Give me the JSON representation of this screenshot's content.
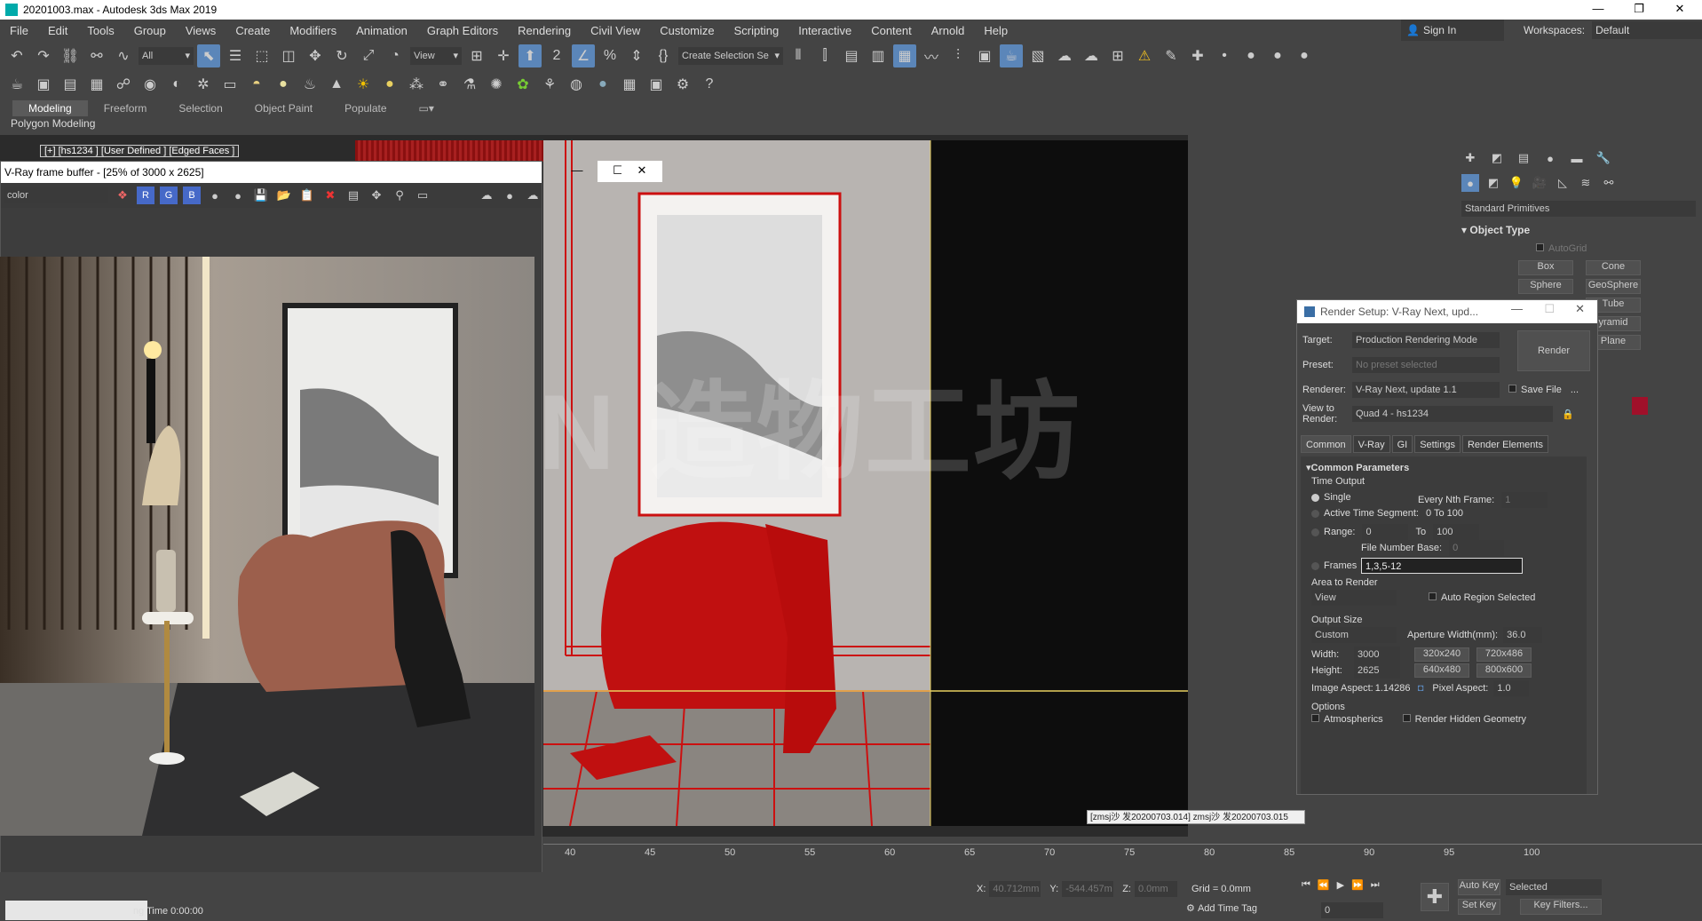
{
  "titlebar": {
    "title": "20201003.max - Autodesk 3ds Max 2019",
    "min": "—",
    "restore": "❐",
    "close": "✕"
  },
  "menu": [
    "File",
    "Edit",
    "Tools",
    "Group",
    "Views",
    "Create",
    "Modifiers",
    "Animation",
    "Graph Editors",
    "Rendering",
    "Civil View",
    "Customize",
    "Scripting",
    "Interactive",
    "Content",
    "Arnold",
    "Help"
  ],
  "signin": "Sign In",
  "workspaces": {
    "label": "Workspaces:",
    "value": "Default"
  },
  "toolbar": {
    "filter": "All",
    "refcoord": "View",
    "selection_set": "Create Selection Se"
  },
  "ribbon": {
    "tabs": [
      "Modeling",
      "Freeform",
      "Selection",
      "Object Paint",
      "Populate"
    ],
    "sub": "Polygon Modeling"
  },
  "viewport": {
    "label": "[+] [hs1234 ] [User Defined ] [Edged Faces ]",
    "tooltip": "[zmsj沙 发20200703.014] zmsj沙 发20200703.015"
  },
  "watermark": "N 造物工坊",
  "vfb": {
    "title": "V-Ray frame buffer - [25% of 3000 x 2625]",
    "channel": "color",
    "ch_r": "R",
    "ch_g": "G",
    "ch_b": "B"
  },
  "cmdpanel": {
    "category": "Standard Primitives",
    "rollout": "Object Type",
    "autogrid": "AutoGrid",
    "buttons": [
      "Box",
      "Cone",
      "Sphere",
      "GeoSphere",
      "Tube",
      "yramid",
      "Plane"
    ],
    "swatch": "#a0102a"
  },
  "rsetup": {
    "title": "Render Setup: V-Ray Next, upd...",
    "target_label": "Target:",
    "target": "Production Rendering Mode",
    "preset_label": "Preset:",
    "preset": "No preset selected",
    "renderer_label": "Renderer:",
    "renderer": "V-Ray Next, update 1.1",
    "savefile": "Save File",
    "view_label": "View to Render:",
    "view": "Quad 4 - hs1234",
    "render_btn": "Render",
    "tabs": [
      "Common",
      "V-Ray",
      "GI",
      "Settings",
      "Render Elements"
    ],
    "rollout": "Common Parameters",
    "time_output": "Time Output",
    "single": "Single",
    "every_nth": "Every Nth Frame:",
    "every_nth_val": "1",
    "active_seg": "Active Time Segment:",
    "active_seg_val": "0 To 100",
    "range": "Range:",
    "range_from": "0",
    "range_to_label": "To",
    "range_to": "100",
    "file_base": "File Number Base:",
    "file_base_val": "0",
    "frames": "Frames",
    "frames_val": "1,3,5-12",
    "area": "Area to Render",
    "area_val": "View",
    "auto_region": "Auto Region Selected",
    "output_size": "Output Size",
    "output_preset": "Custom",
    "aperture": "Aperture Width(mm):",
    "aperture_val": "36.0",
    "width_label": "Width:",
    "width": "3000",
    "height_label": "Height:",
    "height": "2625",
    "presets": [
      "320x240",
      "720x486",
      "640x480",
      "800x600"
    ],
    "aspect_label": "Image Aspect:",
    "aspect": "1.14286",
    "pixel_label": "Pixel Aspect:",
    "pixel": "1.0",
    "options": "Options",
    "atmos": "Atmospherics",
    "hidden": "Render Hidden Geometry"
  },
  "timeline": {
    "ticks": [
      "40",
      "45",
      "50",
      "55",
      "60",
      "65",
      "70",
      "75",
      "80",
      "85",
      "90",
      "95",
      "100"
    ]
  },
  "status": {
    "x_label": "X:",
    "x": "40.712mm",
    "y_label": "Y:",
    "y": "-544.457m",
    "z_label": "Z:",
    "z": "0.0mm",
    "grid": "Grid = 0.0mm",
    "time_tag": "Add Time Tag",
    "autokey": "Auto Key",
    "selected": "Selected",
    "setkey": "Set Key",
    "keyfilters": "Key Filters...",
    "frame": "0",
    "ng_time": "ng Time  0:00:00"
  }
}
